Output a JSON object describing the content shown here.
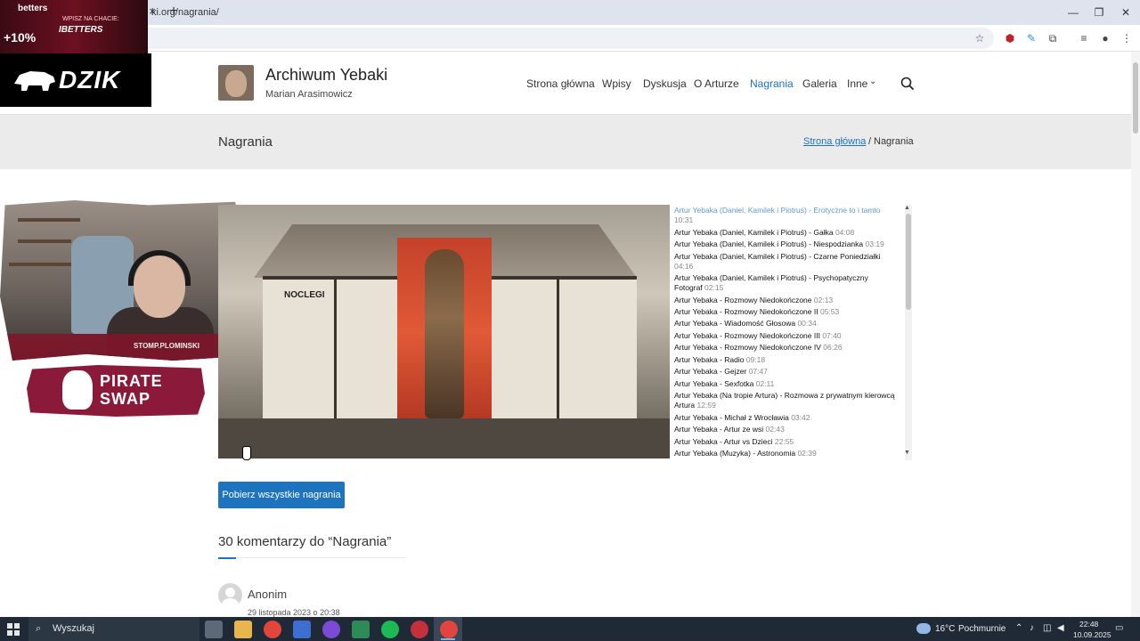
{
  "browser": {
    "url": "ki.org/nagrania/",
    "new_tab": "+",
    "close_tab": "×",
    "win_min": "—",
    "win_max": "❐",
    "win_close": "✕"
  },
  "overlays": {
    "betters_brand": "betters",
    "betters_bonus": "+10%",
    "betters_small": "WPISZ NA CHACIE:",
    "betters_code": "IBETTERS",
    "dzik": "DZIK",
    "cam_handle": "STOMP.PLOMINSKI",
    "pirate_line1": "PIRATE",
    "pirate_line2": "SWAP"
  },
  "site": {
    "title": "Archiwum Yebaki",
    "subtitle": "Marian Arasimowicz",
    "nav": [
      "Strona główna",
      "Wpisy",
      "Dyskusja",
      "O Arturze",
      "Nagrania",
      "Galeria",
      "Inne"
    ],
    "active_nav": "Nagrania"
  },
  "page": {
    "title": "Nagrania",
    "breadcrumb_home": "Strona główna",
    "breadcrumb_sep": "/",
    "breadcrumb_current": "Nagrania"
  },
  "player": {
    "sign_text": "NOCLEGI",
    "playlist": [
      {
        "title": "Artur Yebaka (Daniel, Kamilek i Piotruś) - Erotyczne to i tamto",
        "duration": "10:31",
        "active": true
      },
      {
        "title": "Artur Yebaka (Daniel, Kamilek i Piotruś) - Gałka",
        "duration": "04:08"
      },
      {
        "title": "Artur Yebaka (Daniel, Kamilek i Piotruś) - Niespodzianka",
        "duration": "03:19"
      },
      {
        "title": "Artur Yebaka (Daniel, Kamilek i Piotruś) - Czarne Poniedziałki",
        "duration": "04:16"
      },
      {
        "title": "Artur Yebaka (Daniel, Kamilek i Piotruś) - Psychopatyczny Fotograf",
        "duration": "02:15"
      },
      {
        "title": "Artur Yebaka - Rozmowy Niedokończone",
        "duration": "02:13"
      },
      {
        "title": "Artur Yebaka - Rozmowy Niedokończone II",
        "duration": "05:53"
      },
      {
        "title": "Artur Yebaka - Wiadomość Głosowa",
        "duration": "00:34"
      },
      {
        "title": "Artur Yebaka - Rozmowy Niedokończone III",
        "duration": "07:40"
      },
      {
        "title": "Artur Yebaka - Rozmowy Niedokończone IV",
        "duration": "06:26"
      },
      {
        "title": "Artur Yebaka - Radio",
        "duration": "09:18"
      },
      {
        "title": "Artur Yebaka - Gejzer",
        "duration": "07:47"
      },
      {
        "title": "Artur Yebaka - Sexfotka",
        "duration": "02:11"
      },
      {
        "title": "Artur Yebaka (Na tropie Artura) - Rozmowa z prywatnym kierowcą Artura",
        "duration": "12:59"
      },
      {
        "title": "Artur Yebaka - Michał z Wrocławia",
        "duration": "03:42"
      },
      {
        "title": "Artur Yebaka - Artur ze wsi",
        "duration": "02:43"
      },
      {
        "title": "Artur Yebaka - Artur vs Dzieci",
        "duration": "22:55"
      },
      {
        "title": "Artur Yebaka (Muzyka) - Astronomia",
        "duration": "02:39"
      }
    ]
  },
  "download_label": "Pobierz wszystkie nagrania",
  "comments": {
    "heading": "30 komentarzy do “Nagrania”",
    "first_author": "Anonim",
    "first_date": "29 listopada 2023 o 20:38"
  },
  "taskbar": {
    "search_label": "Wyszukaj",
    "temp": "16°C",
    "weather": "Pochmurnie",
    "time": "22:48",
    "date": "10.09.2025"
  },
  "colors": {
    "accent": "#1e73be",
    "taskbar": "#1f2a36"
  }
}
